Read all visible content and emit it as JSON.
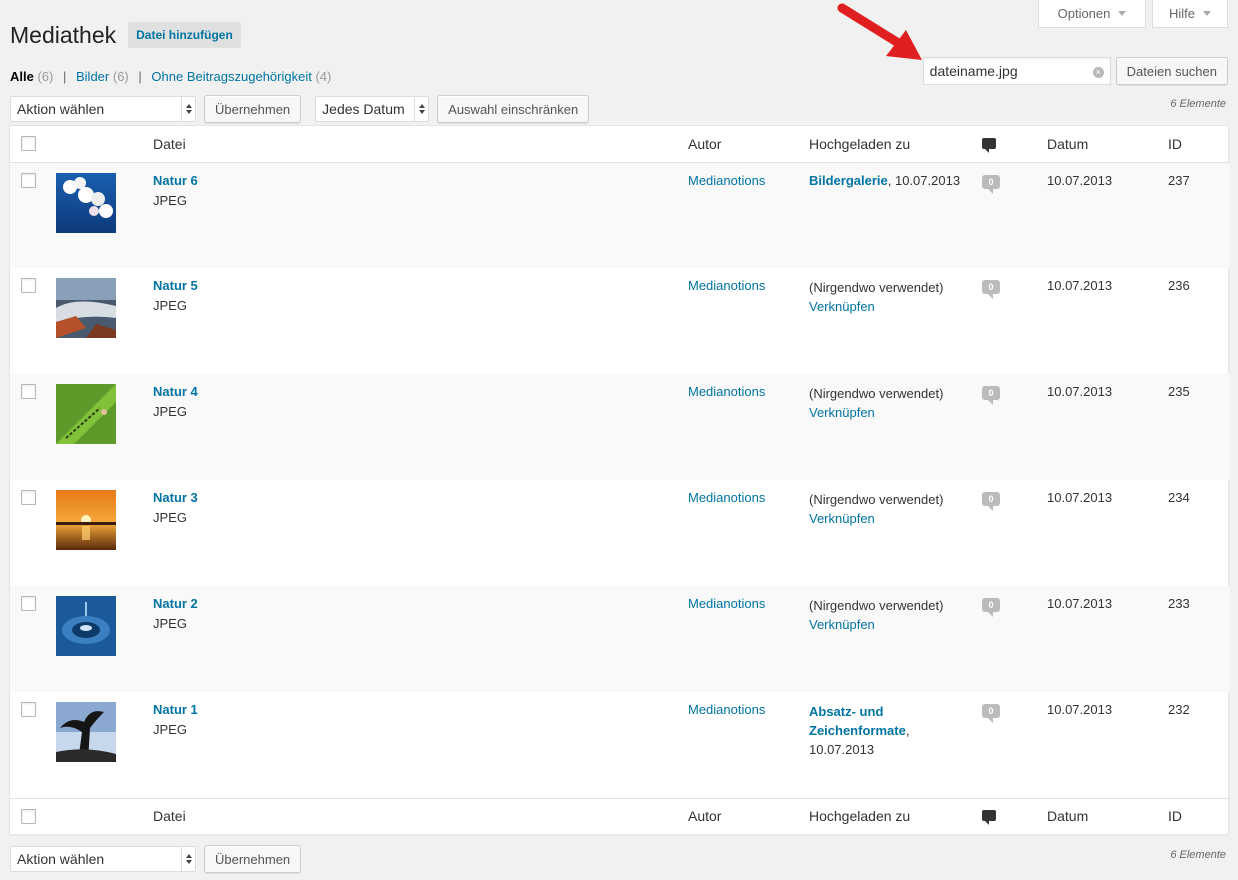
{
  "screen_meta": {
    "options_label": "Optionen",
    "help_label": "Hilfe"
  },
  "header": {
    "title": "Mediathek",
    "add_new_label": "Datei hinzufügen"
  },
  "views": [
    {
      "label": "Alle",
      "count": "(6)",
      "current": true
    },
    {
      "label": "Bilder",
      "count": "(6)",
      "current": false
    },
    {
      "label": "Ohne Beitragszugehörigkeit",
      "count": "(4)",
      "current": false
    }
  ],
  "separator": "|",
  "search": {
    "value": "dateiname.jpg",
    "button_label": "Dateien suchen",
    "clear_icon": "×"
  },
  "tablenav_top": {
    "bulk_action": "Aktion wählen",
    "apply_label": "Übernehmen",
    "date_filter": "Jedes Datum",
    "filter_label": "Auswahl einschränken",
    "items_count": "6 Elemente"
  },
  "tablenav_bottom": {
    "bulk_action": "Aktion wählen",
    "apply_label": "Übernehmen",
    "items_count": "6 Elemente"
  },
  "columns": {
    "file": "Datei",
    "author": "Autor",
    "uploaded_to": "Hochgeladen zu",
    "comments_icon": "comment-icon",
    "date": "Datum",
    "id": "ID"
  },
  "rows": [
    {
      "title": "Natur 6",
      "mime": "JPEG",
      "author": "Medianotions",
      "parent": "Bildergalerie",
      "parent_suffix": ", 10.07.2013",
      "comments": "0",
      "date": "10.07.2013",
      "id": "237",
      "thumb": "orchid-blue-sky"
    },
    {
      "title": "Natur 5",
      "mime": "JPEG",
      "author": "Medianotions",
      "unattached": "(Nirgendwo verwendet)",
      "attach": "Verknüpfen",
      "comments": "0",
      "date": "10.07.2013",
      "id": "236",
      "thumb": "coast-sunset"
    },
    {
      "title": "Natur 4",
      "mime": "JPEG",
      "author": "Medianotions",
      "unattached": "(Nirgendwo verwendet)",
      "attach": "Verknüpfen",
      "comments": "0",
      "date": "10.07.2013",
      "id": "235",
      "thumb": "green-leaf"
    },
    {
      "title": "Natur 3",
      "mime": "JPEG",
      "author": "Medianotions",
      "unattached": "(Nirgendwo verwendet)",
      "attach": "Verknüpfen",
      "comments": "0",
      "date": "10.07.2013",
      "id": "234",
      "thumb": "orange-sunset-sea"
    },
    {
      "title": "Natur 2",
      "mime": "JPEG",
      "author": "Medianotions",
      "unattached": "(Nirgendwo verwendet)",
      "attach": "Verknüpfen",
      "comments": "0",
      "date": "10.07.2013",
      "id": "233",
      "thumb": "water-drop"
    },
    {
      "title": "Natur 1",
      "mime": "JPEG",
      "author": "Medianotions",
      "parent": "Absatz- und Zeichenformate",
      "parent_suffix": ",",
      "parent_date": "10.07.2013",
      "comments": "0",
      "date": "10.07.2013",
      "id": "232",
      "thumb": "tree-silhouette"
    }
  ],
  "colors": {
    "link": "#0074a2",
    "arrow": "#e02020"
  }
}
